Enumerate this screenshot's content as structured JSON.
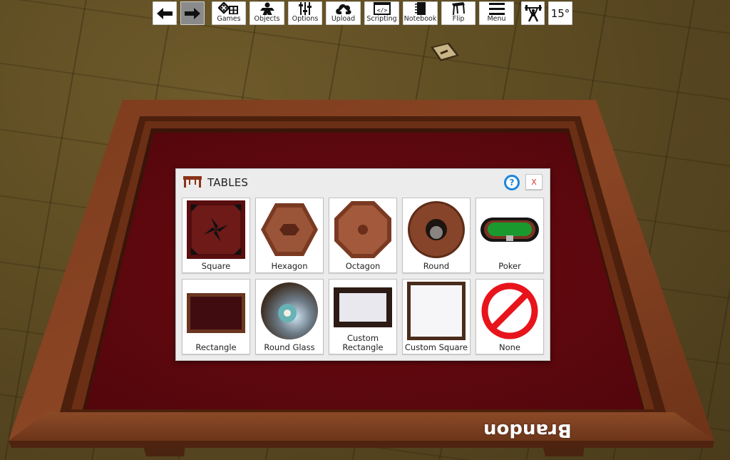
{
  "toolbar": {
    "back": {
      "icon": "arrow-left-icon"
    },
    "forward": {
      "icon": "arrow-right-icon",
      "pressed": true
    },
    "buttons": [
      {
        "label": "Games",
        "icon": "dice-icon"
      },
      {
        "label": "Objects",
        "icon": "meeple-icon"
      },
      {
        "label": "Options",
        "icon": "sliders-icon"
      },
      {
        "label": "Upload",
        "icon": "upload-cloud-icon"
      },
      {
        "label": "Scripting",
        "icon": "code-window-icon"
      },
      {
        "label": "Notebook",
        "icon": "notebook-icon"
      },
      {
        "label": "Flip",
        "icon": "flip-table-icon"
      },
      {
        "label": "Menu",
        "icon": "hamburger-menu-icon"
      }
    ],
    "lift": {
      "icon": "weightlifter-icon"
    },
    "rotation": {
      "value": "15°"
    }
  },
  "dialog": {
    "title": "TABLES",
    "icon": "table-icon",
    "help_label": "?",
    "close_label": "X",
    "tiles": [
      {
        "label": "Square",
        "icon": "square-table-thumb"
      },
      {
        "label": "Hexagon",
        "icon": "hexagon-table-thumb"
      },
      {
        "label": "Octagon",
        "icon": "octagon-table-thumb"
      },
      {
        "label": "Round",
        "icon": "round-table-thumb"
      },
      {
        "label": "Poker",
        "icon": "poker-table-thumb"
      },
      {
        "label": "Rectangle",
        "icon": "rectangle-table-thumb"
      },
      {
        "label": "Round Glass",
        "icon": "round-glass-table-thumb"
      },
      {
        "label": "Custom Rectangle",
        "icon": "custom-rectangle-table-thumb"
      },
      {
        "label": "Custom Square",
        "icon": "custom-square-table-thumb"
      },
      {
        "label": "None",
        "icon": "none-prohibited-icon"
      }
    ]
  },
  "scene": {
    "player_name": "Brandon",
    "felt_color": "#5a0a10",
    "wood_color": "#7a3a1c",
    "floor_color": "#5a4a1f"
  }
}
